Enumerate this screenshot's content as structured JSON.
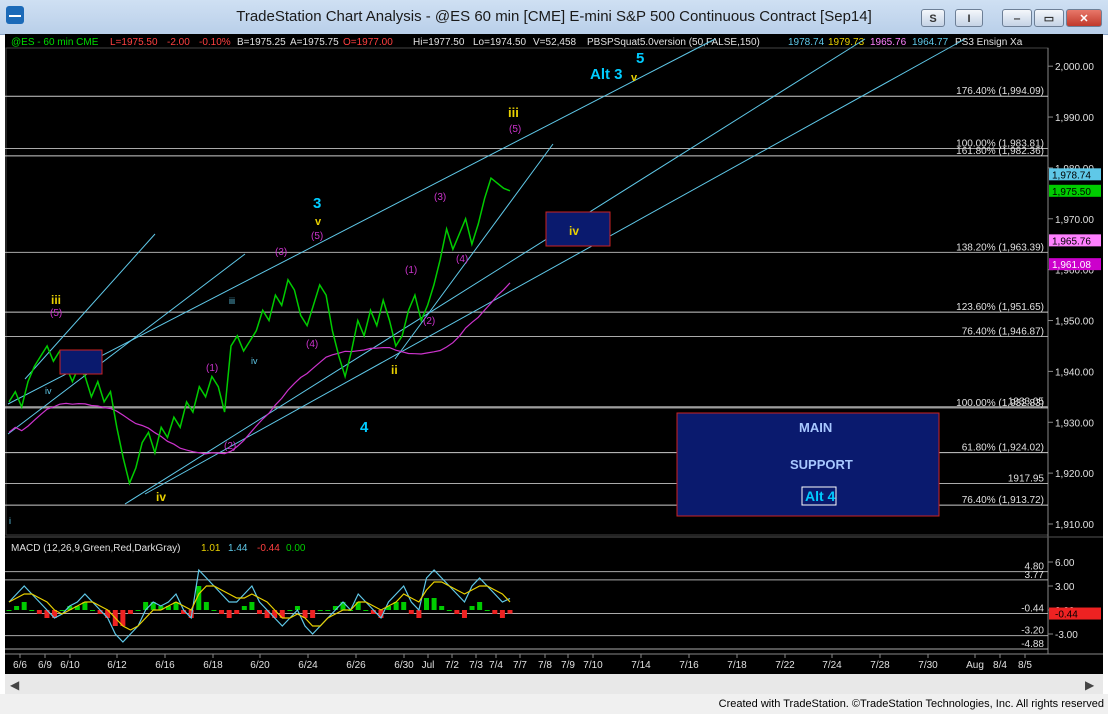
{
  "window": {
    "title": "TradeStation Chart Analysis - @ES 60 min [CME] E-mini S&P 500 Continuous Contract [Sep14]",
    "btn_s": "S",
    "btn_i": "I",
    "btn_min": "‒",
    "btn_max": "▭",
    "btn_close": "✕"
  },
  "header": {
    "symbol": "@ES - 60 min  CME",
    "last": "L=1975.50",
    "chg": "-2.00",
    "pct": "-0.10%",
    "bid": "B=1975.25",
    "ask": "A=1975.75",
    "open": "O=1977.00",
    "hi": "Hi=1977.50",
    "lo": "Lo=1974.50",
    "vol": "V=52,458",
    "study": "PBSPSquat5.0version (50,FALSE,150)",
    "s1": "1978.74",
    "s2": "1979.73",
    "s3": "1965.76",
    "s4": "1964.77",
    "study2": "PS3 Ensign Xa"
  },
  "macd_header": {
    "name": "MACD (12,26,9,Green,Red,DarkGray)",
    "v1": "1.01",
    "v2": "1.44",
    "v3": "-0.44",
    "v4": "0.00"
  },
  "footer": {
    "credit": "Created with TradeStation. ©TradeStation Technologies, Inc. All rights reserved"
  },
  "colors": {
    "price": "#00cc00",
    "channel": "#5fc8e8",
    "magenta_ma": "#cc33cc",
    "wave_yellow": "#e8d000",
    "wave_cyan": "#00ccff",
    "wave_purple": "#cc33cc",
    "box_fill": "#0a1a6e",
    "box_border": "#cc2222"
  },
  "chart_data": [
    {
      "type": "line",
      "title": "",
      "ylim": [
        1910,
        2002
      ],
      "yticks": [
        "2,000.00",
        "1,990.00",
        "1,980.00",
        "1,970.00",
        "1,960.00",
        "1,950.00",
        "1,940.00",
        "1,930.00",
        "1,920.00",
        "1,910.00"
      ],
      "xticks": [
        "6/6",
        "6/9",
        "6/10",
        "6/12",
        "6/16",
        "6/18",
        "6/20",
        "6/24",
        "6/26",
        "6/30",
        "Jul",
        "7/2",
        "7/3",
        "7/4",
        "7/7",
        "7/8",
        "7/9",
        "7/10",
        "7/14",
        "7/16",
        "7/18",
        "7/22",
        "7/24",
        "7/28",
        "7/30",
        "Aug",
        "8/4",
        "8/5"
      ],
      "series": [
        {
          "values": [
            1934,
            1936,
            1933,
            1938,
            1941,
            1943,
            1945,
            1942,
            1944,
            1941,
            1938,
            1941,
            1939,
            1935,
            1938,
            1934,
            1936,
            1929,
            1923,
            1918,
            1921,
            1926,
            1928,
            1924,
            1929,
            1927,
            1931,
            1929,
            1934,
            1932,
            1937,
            1935,
            1939,
            1937,
            1932,
            1945,
            1947,
            1944,
            1946,
            1948,
            1952,
            1950,
            1955,
            1953,
            1958,
            1956,
            1951,
            1949,
            1953,
            1957,
            1955,
            1948,
            1943,
            1939,
            1944,
            1950,
            1947,
            1952,
            1949,
            1954,
            1950,
            1945,
            1947,
            1952,
            1955,
            1950,
            1953,
            1957,
            1962,
            1968,
            1964,
            1967,
            1970,
            1965,
            1969,
            1974,
            1978,
            1977,
            1976,
            1975.5
          ]
        }
      ],
      "price_labels": {
        "p1": "1,978.74",
        "p2": "1,975.50",
        "p3": "1,965.76",
        "p4": "1,961.08"
      },
      "levels": [
        {
          "label": "176.40% (1,994.09)",
          "value": 1994.09
        },
        {
          "label": "100.00% (1,983.81)",
          "value": 1983.81
        },
        {
          "label": "161.80% (1,982.36)",
          "value": 1982.36
        },
        {
          "label": "138.20% (1,963.39)",
          "value": 1963.39
        },
        {
          "label": "123.60% (1,951.65)",
          "value": 1951.65
        },
        {
          "label": "76.40% (1,946.87)",
          "value": 1946.87
        },
        {
          "label": "100.00% (1,932.83)",
          "value": 1932.83
        },
        {
          "label": "1933.05",
          "value": 1933.05
        },
        {
          "label": "61.80% (1,924.02)",
          "value": 1924.02
        },
        {
          "label": "1917.95",
          "value": 1917.95
        },
        {
          "label": "76.40% (1,913.72)",
          "value": 1913.72
        }
      ],
      "annotations": {
        "alt3": "Alt 3",
        "five": "5",
        "v_top": "v",
        "iii_top": "iii",
        "p5_top": "(5)",
        "w3": "3",
        "w3v": "v",
        "w3p5": "(5)",
        "iv_box": "iv",
        "p3_a": "(3)",
        "p3_b": "(3)",
        "p4_a": "(4)",
        "p4_b": "(4)",
        "p1_a": "(1)",
        "p1_b": "(1)",
        "p2_a": "(2)",
        "p2_b": "(2)",
        "ii_w": "ii",
        "w4": "4",
        "iii_left": "iii",
        "p5_left": "(5)",
        "iii_s": "iii",
        "iv_s": "iv",
        "iv_s2": "iv",
        "iv_bottom": "iv",
        "i_left": "i",
        "main": "MAIN",
        "support": "SUPPORT",
        "alt4": "Alt 4"
      }
    },
    {
      "type": "line",
      "title": "",
      "ylim": [
        -5,
        7
      ],
      "yticks": [
        "6.00",
        "3.00",
        "0.00",
        "-3.00"
      ],
      "levels": [
        {
          "label": "4.80",
          "value": 4.8
        },
        {
          "label": "3.77",
          "value": 3.77
        },
        {
          "label": "-3.20",
          "value": -3.2
        },
        {
          "label": "-4.88",
          "value": -4.88
        },
        {
          "label": "-0.44",
          "value": -0.44
        }
      ],
      "series": [
        {
          "name": "MACD",
          "values": [
            1,
            2,
            3,
            2,
            1,
            0,
            -1,
            -0.5,
            0.5,
            1,
            2,
            1,
            0,
            -1,
            -3,
            -4,
            -3,
            -2,
            0,
            1,
            0.5,
            1,
            2,
            0,
            -1,
            5,
            4,
            3,
            2,
            1,
            1,
            2,
            3,
            1,
            0,
            -1,
            -2,
            -1,
            0,
            -2,
            -3,
            -2,
            -1,
            0,
            1,
            0,
            2,
            1,
            0,
            -1,
            1,
            2,
            3,
            1,
            0,
            4,
            5,
            4,
            3,
            2,
            1,
            3,
            4,
            3,
            2,
            1,
            1.44
          ]
        },
        {
          "name": "Avg",
          "values": [
            1,
            1.5,
            2,
            2,
            1.5,
            1,
            0,
            -0.5,
            0,
            0.5,
            1,
            1,
            0.5,
            0,
            -1,
            -2,
            -2.5,
            -2,
            -1,
            0,
            0,
            0.5,
            1,
            0.5,
            0,
            2,
            3,
            3,
            2.5,
            2,
            1.5,
            1.5,
            2,
            1.5,
            1,
            0,
            -1,
            -1,
            -0.5,
            -1,
            -2,
            -2,
            -1,
            -0.5,
            0,
            0,
            1,
            1,
            0.5,
            0,
            0.5,
            1,
            2,
            1.5,
            1,
            2.5,
            3.5,
            3.5,
            3,
            2.5,
            2,
            2.5,
            3,
            3,
            2.5,
            2,
            1.01
          ]
        }
      ],
      "histogram": [
        0,
        0.5,
        1,
        0,
        -0.5,
        -1,
        -1,
        0,
        0.5,
        0.5,
        1,
        0,
        -0.5,
        -1,
        -2,
        -2,
        -0.5,
        0,
        1,
        1,
        0.5,
        0.5,
        1,
        -0.5,
        -1,
        3,
        1,
        0,
        -0.5,
        -1,
        -0.5,
        0.5,
        1,
        -0.5,
        -1,
        -1,
        -1,
        0,
        0.5,
        -1,
        -1,
        0,
        0,
        0.5,
        1,
        0,
        1,
        0,
        -0.5,
        -1,
        0.5,
        1,
        1,
        -0.5,
        -1,
        1.5,
        1.5,
        0.5,
        0,
        -0.5,
        -1,
        0.5,
        1,
        0,
        -0.5,
        -1,
        -0.44
      ]
    }
  ]
}
